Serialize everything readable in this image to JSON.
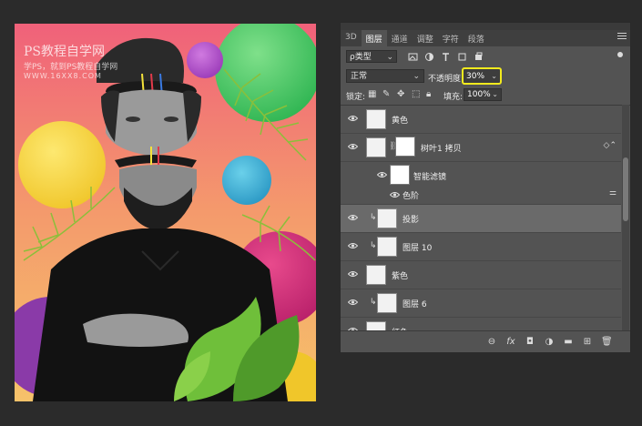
{
  "watermark": {
    "title": "PS教程自学网",
    "subtitle": "学PS，就到PS教程自学网",
    "url": "WWW.16XX8.COM"
  },
  "panel": {
    "tabs": [
      "3D",
      "图层",
      "通道",
      "调整",
      "字符",
      "段落"
    ],
    "active_tab": "图层",
    "filter_kind": "ρ类型",
    "blend_mode": "正常",
    "opacity_label": "不透明度:",
    "opacity_value": "30%",
    "lock_label": "锁定:",
    "fill_label": "填充:",
    "fill_value": "100%",
    "highlight_color": "#f2ea1e"
  },
  "layers": [
    {
      "name": "黄色",
      "clipped": false,
      "selected": false
    },
    {
      "name": "树叶1 拷贝",
      "clipped": false,
      "selected": false,
      "has_mask": true,
      "has_effects_icon": true
    },
    {
      "name": "智能滤镜",
      "clipped": false,
      "selected": false,
      "sub": true
    },
    {
      "name": "色阶",
      "clipped": false,
      "selected": false,
      "sub": true
    },
    {
      "name": "投影",
      "clipped": true,
      "selected": true
    },
    {
      "name": "图层 10",
      "clipped": true,
      "selected": false
    },
    {
      "name": "紫色",
      "clipped": false,
      "selected": false
    },
    {
      "name": "图层 6",
      "clipped": true,
      "selected": false
    },
    {
      "name": "红色",
      "clipped": false,
      "selected": false
    }
  ]
}
